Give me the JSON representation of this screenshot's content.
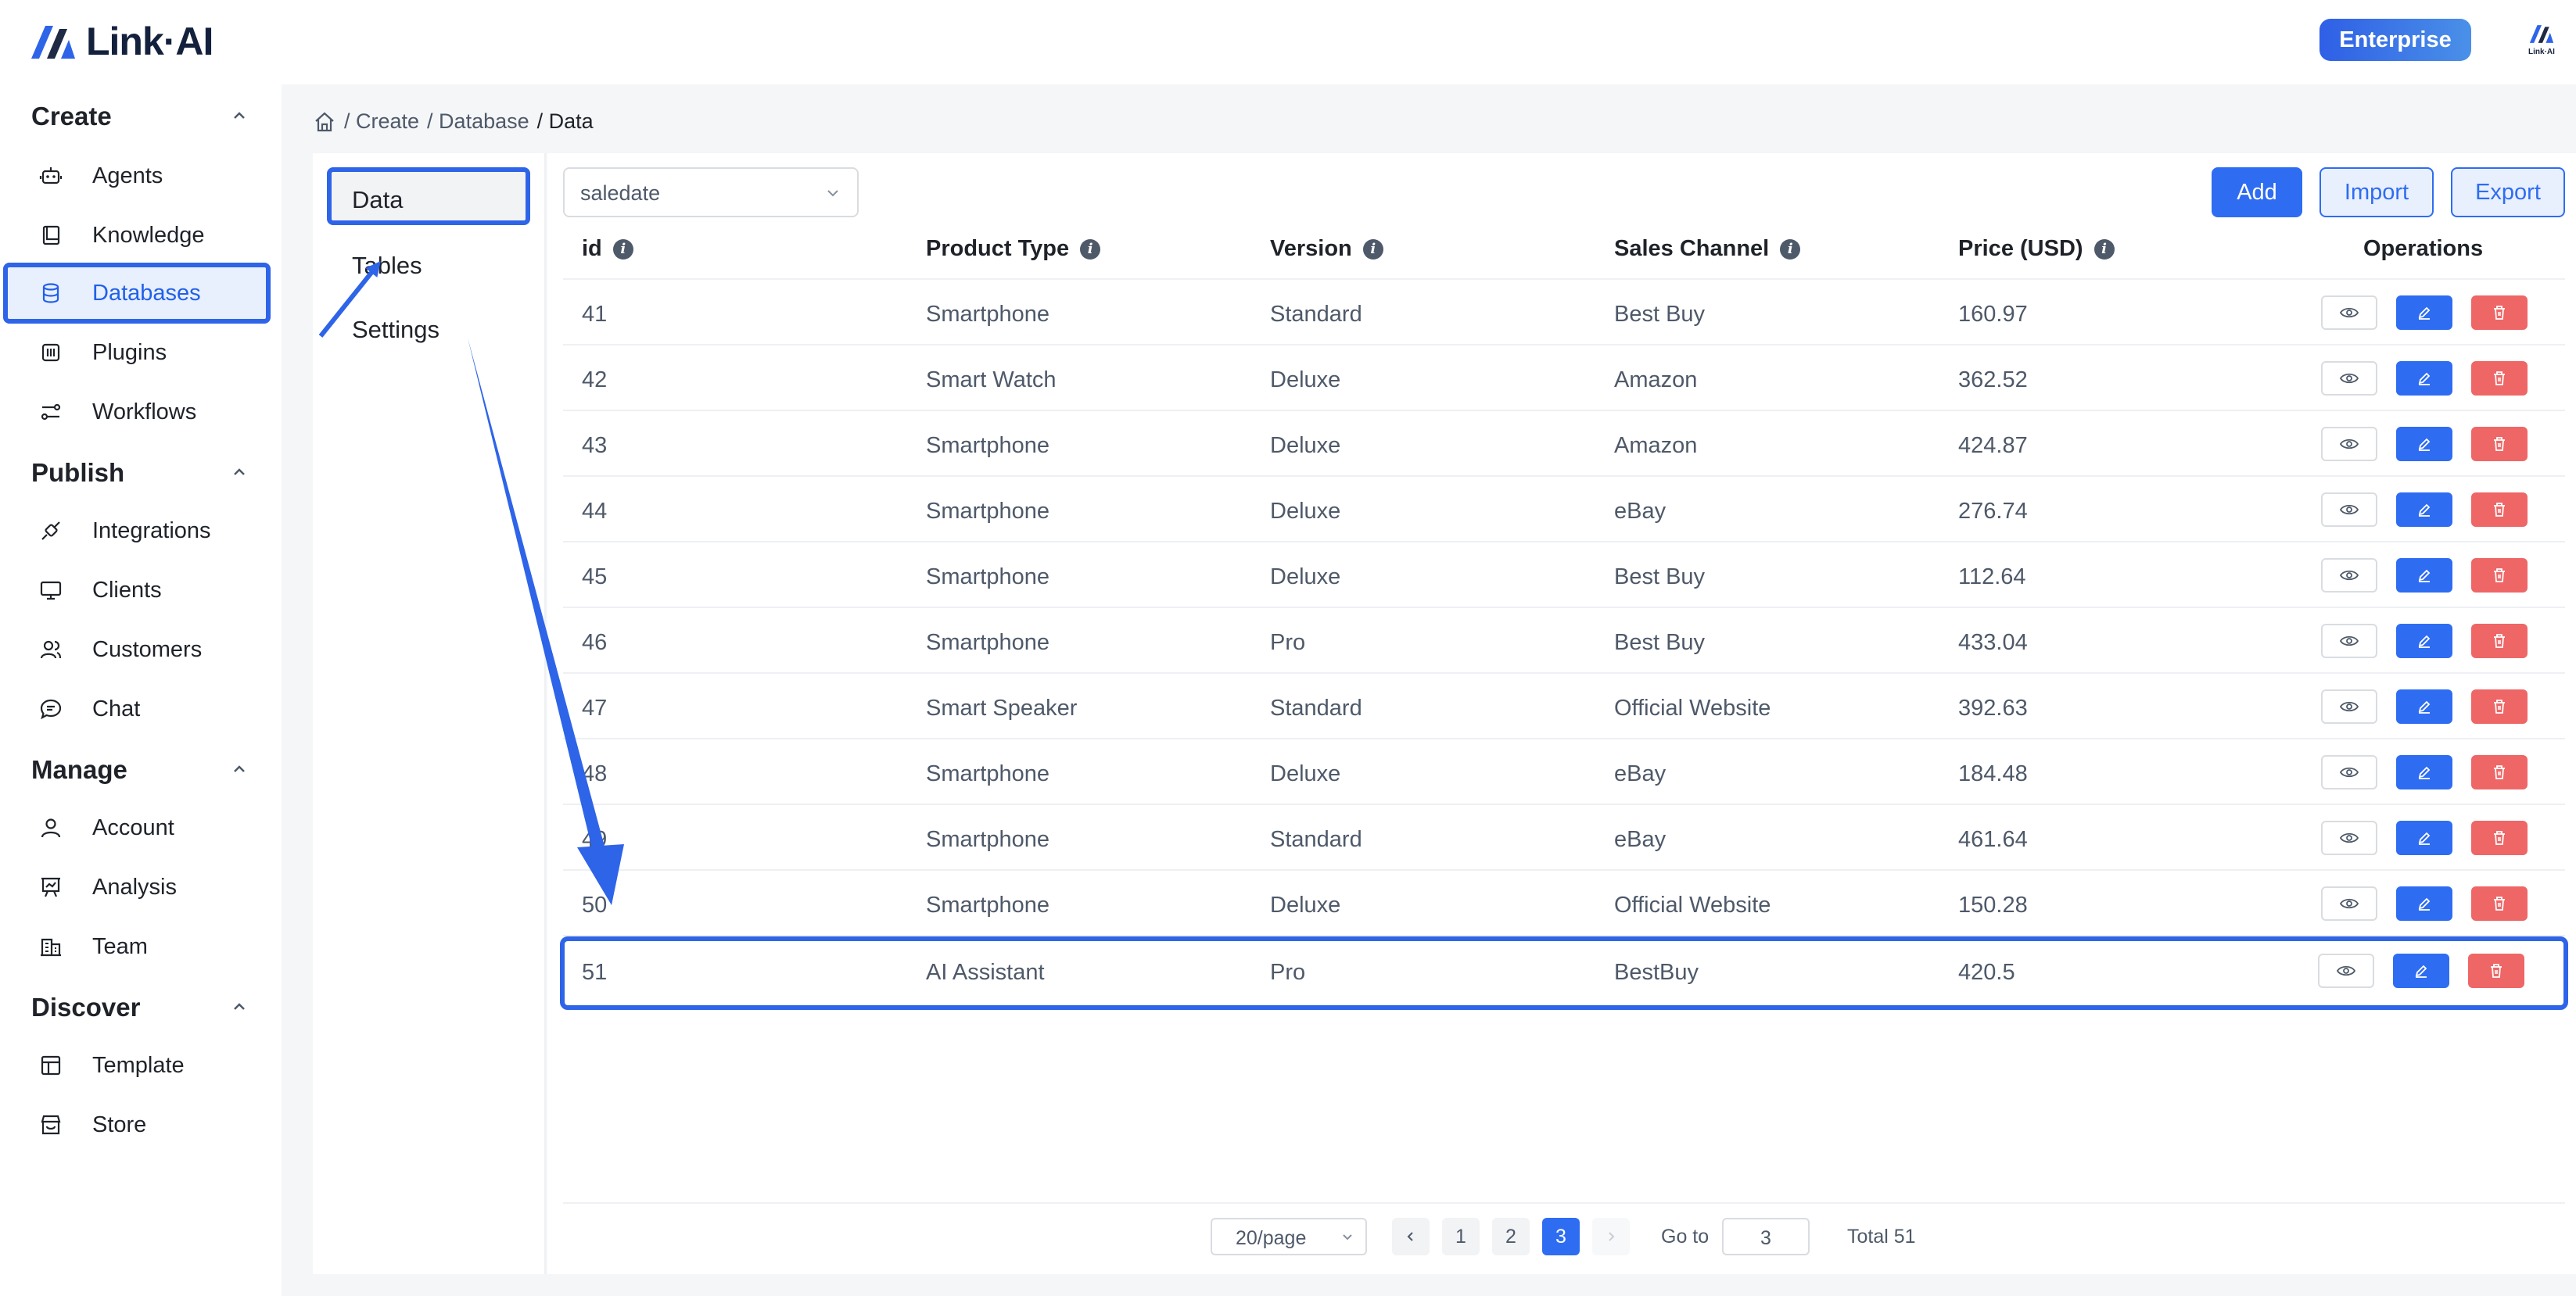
{
  "header": {
    "logo_text": "Link·AI",
    "enterprise_label": "Enterprise",
    "mini_logo_text": "Link·AI"
  },
  "sidebar": {
    "sections": [
      {
        "title": "Create",
        "items": [
          {
            "label": "Agents",
            "icon": "robot-icon"
          },
          {
            "label": "Knowledge",
            "icon": "book-icon"
          },
          {
            "label": "Databases",
            "icon": "database-icon",
            "active": true
          },
          {
            "label": "Plugins",
            "icon": "plugin-icon"
          },
          {
            "label": "Workflows",
            "icon": "workflow-icon"
          }
        ]
      },
      {
        "title": "Publish",
        "items": [
          {
            "label": "Integrations",
            "icon": "plug-icon"
          },
          {
            "label": "Clients",
            "icon": "monitor-icon"
          },
          {
            "label": "Customers",
            "icon": "users-icon"
          },
          {
            "label": "Chat",
            "icon": "chat-icon"
          }
        ]
      },
      {
        "title": "Manage",
        "items": [
          {
            "label": "Account",
            "icon": "user-icon"
          },
          {
            "label": "Analysis",
            "icon": "chart-board-icon"
          },
          {
            "label": "Team",
            "icon": "building-icon"
          }
        ]
      },
      {
        "title": "Discover",
        "items": [
          {
            "label": "Template",
            "icon": "template-icon"
          },
          {
            "label": "Store",
            "icon": "store-icon"
          }
        ]
      }
    ]
  },
  "breadcrumb": {
    "items": [
      "/ Create",
      "/ Database",
      "/ Data"
    ]
  },
  "subnav": {
    "tabs": [
      "Data",
      "Tables",
      "Settings"
    ],
    "active": "Data"
  },
  "toolbar": {
    "field_select_value": "saledate",
    "add_label": "Add",
    "import_label": "Import",
    "export_label": "Export"
  },
  "table": {
    "columns": [
      "id",
      "Product Type",
      "Version",
      "Sales Channel",
      "Price (USD)",
      "Operations"
    ],
    "rows": [
      [
        "41",
        "Smartphone",
        "Standard",
        "Best Buy",
        "160.97"
      ],
      [
        "42",
        "Smart Watch",
        "Deluxe",
        "Amazon",
        "362.52"
      ],
      [
        "43",
        "Smartphone",
        "Deluxe",
        "Amazon",
        "424.87"
      ],
      [
        "44",
        "Smartphone",
        "Deluxe",
        "eBay",
        "276.74"
      ],
      [
        "45",
        "Smartphone",
        "Deluxe",
        "Best Buy",
        "112.64"
      ],
      [
        "46",
        "Smartphone",
        "Pro",
        "Best Buy",
        "433.04"
      ],
      [
        "47",
        "Smart Speaker",
        "Standard",
        "Official Website",
        "392.63"
      ],
      [
        "48",
        "Smartphone",
        "Deluxe",
        "eBay",
        "184.48"
      ],
      [
        "49",
        "Smartphone",
        "Standard",
        "eBay",
        "461.64"
      ],
      [
        "50",
        "Smartphone",
        "Deluxe",
        "Official Website",
        "150.28"
      ],
      [
        "51",
        "AI Assistant",
        "Pro",
        "BestBuy",
        "420.5"
      ]
    ],
    "highlighted_row_id": "51"
  },
  "pagination": {
    "page_size": "20/page",
    "pages": [
      "1",
      "2",
      "3"
    ],
    "current_page": "3",
    "goto_label": "Go to",
    "goto_value": "3",
    "total_text": "Total 51"
  },
  "colors": {
    "accent": "#2e6cf2",
    "annotation": "#2e64e8",
    "delete": "#ee6666"
  }
}
